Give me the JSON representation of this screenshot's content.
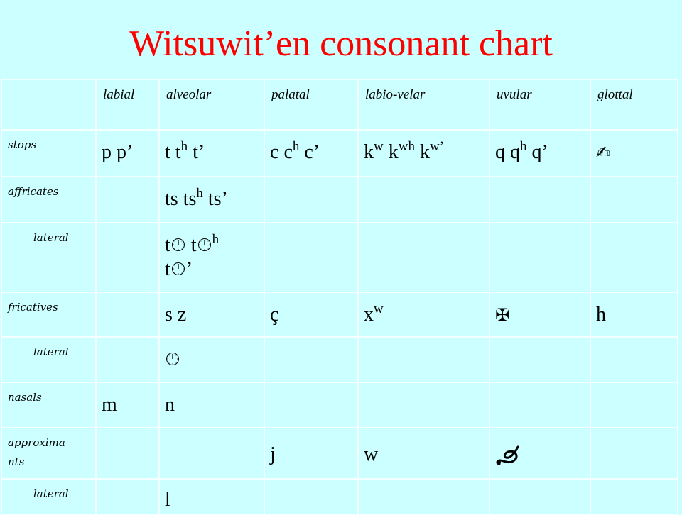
{
  "title": "Witsuwit’en consonant chart",
  "colors": {
    "background": "#CCFFFF",
    "title": "#FF0000",
    "grid": "#F4FFFF",
    "text": "#000000"
  },
  "columns": [
    "labial",
    "alveolar",
    "palatal",
    "labio-velar",
    "uvular",
    "glottal"
  ],
  "rows": [
    {
      "label": "stops",
      "indent": false,
      "cells": [
        "p p’",
        "t tʰ t’",
        "c cʰ c’",
        "kʷ kʷʰ kʷ’",
        "q qʰ q’",
        "ʔ (rendered as writing-hand glyph)"
      ]
    },
    {
      "label": "affricates",
      "indent": false,
      "cells": [
        "",
        "ts tsʰ ts’",
        "",
        "",
        "",
        ""
      ]
    },
    {
      "label": "lateral",
      "indent": true,
      "cells": [
        "",
        "tɬ tɬʰ tɬ’ (ɬ rendered as clock glyph)",
        "",
        "",
        "",
        ""
      ]
    },
    {
      "label": "fricatives",
      "indent": false,
      "cells": [
        "",
        "s z",
        "ç",
        "xʷ",
        "χ (rendered as maltese-cross glyph)",
        "h"
      ]
    },
    {
      "label": "lateral",
      "indent": true,
      "cells": [
        "",
        "ɬ (rendered as clock glyph)",
        "",
        "",
        "",
        ""
      ]
    },
    {
      "label": "nasals",
      "indent": false,
      "cells": [
        "m",
        "n",
        "",
        "",
        "",
        ""
      ]
    },
    {
      "label": "approximants",
      "label_display": "approxima nts",
      "indent": false,
      "cells": [
        "",
        "",
        "j",
        "w",
        "ʁ (rendered as script glyph)",
        ""
      ]
    },
    {
      "label": "lateral",
      "indent": true,
      "cells": [
        "",
        "l",
        "",
        "",
        "",
        ""
      ]
    }
  ],
  "text": {
    "stops_labial": "p p’",
    "t": "t",
    "t_h_sup": "h",
    "t_ej": "t’",
    "c": "c",
    "c_h_sup": "h",
    "c_ej": "c’",
    "k": "k",
    "w_sup": "w",
    "wh_sup": "wh",
    "wq_sup": "w’",
    "q": "q",
    "q_h_sup": "h",
    "q_ej": "q’",
    "glottal_stop_glyph": "✍",
    "ts": "ts",
    "ts_ej": "ts’",
    "tl_t": "t",
    "apos": "’",
    "sz": "s z",
    "c_ced": "ç",
    "x": "x",
    "uvular_fric_glyph": "✠",
    "h": "h",
    "m": "m",
    "n": "n",
    "j": "j",
    "w": "w",
    "uvular_approx_glyph": "ꝺ",
    "l": "l",
    "approx_label_1": "approxima",
    "approx_label_2": "nts"
  }
}
